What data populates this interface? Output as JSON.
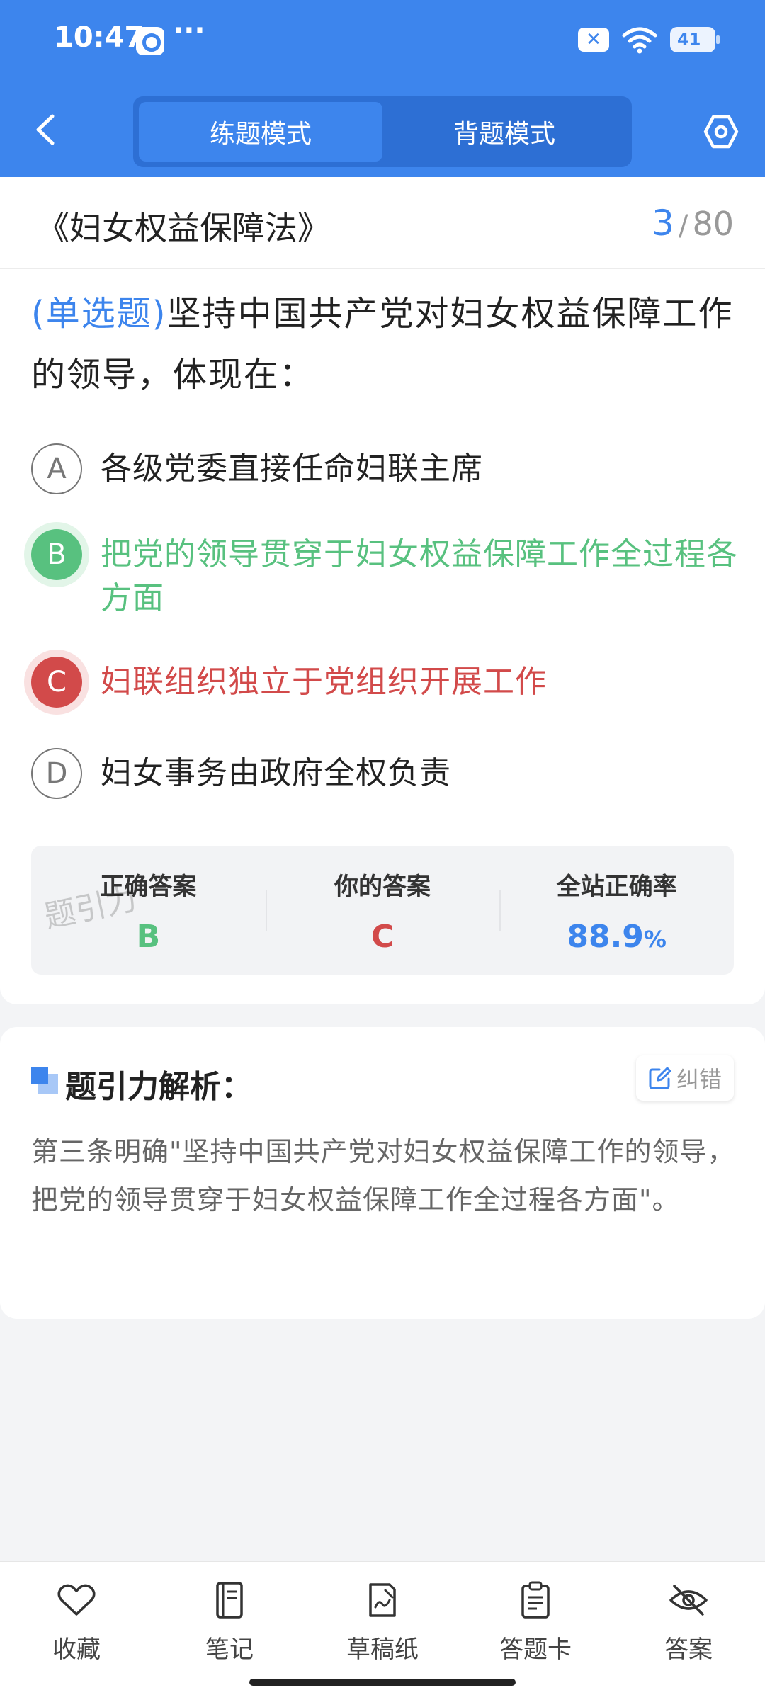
{
  "status_bar": {
    "time": "10:47",
    "more": "···",
    "battery": "41"
  },
  "header": {
    "tabs": [
      {
        "label": "练题模式",
        "active": true
      },
      {
        "label": "背题模式",
        "active": false
      }
    ]
  },
  "question_card": {
    "law_title": "《妇女权益保障法》",
    "current": "3",
    "total": "80",
    "question_type": "(单选题)",
    "question_text": "坚持中国共产党对妇女权益保障工作的领导，体现在：",
    "options": [
      {
        "letter": "A",
        "text": "各级党委直接任命妇联主席",
        "state": "normal"
      },
      {
        "letter": "B",
        "text": "把党的领导贯穿于妇女权益保障工作全过程各方面",
        "state": "correct"
      },
      {
        "letter": "C",
        "text": "妇联组织独立于党组织开展工作",
        "state": "wrong"
      },
      {
        "letter": "D",
        "text": "妇女事务由政府全权负责",
        "state": "normal"
      }
    ],
    "stats": {
      "correct_label": "正确答案",
      "correct_value": "B",
      "yours_label": "你的答案",
      "yours_value": "C",
      "rate_label": "全站正确率",
      "rate_value": "88.9",
      "rate_unit": "%"
    },
    "watermark": "题引力"
  },
  "analysis": {
    "title": "题引力解析：",
    "report_button": "纠错",
    "text": "第三条明确\"坚持中国共产党对妇女权益保障工作的领导，把党的领导贯穿于妇女权益保障工作全过程各方面\"。"
  },
  "bottom_nav": [
    {
      "label": "收藏",
      "icon": "heart-icon"
    },
    {
      "label": "笔记",
      "icon": "notebook-icon"
    },
    {
      "label": "草稿纸",
      "icon": "draft-paper-icon"
    },
    {
      "label": "答题卡",
      "icon": "answer-sheet-icon"
    },
    {
      "label": "答案",
      "icon": "eye-off-icon"
    }
  ],
  "colors": {
    "primary": "#3d85ed",
    "correct": "#58c17f",
    "wrong": "#d24a4a"
  }
}
